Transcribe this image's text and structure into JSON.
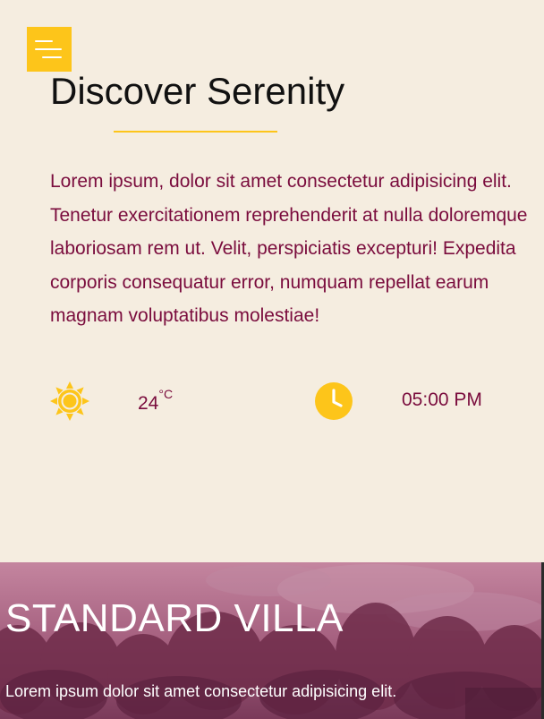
{
  "colors": {
    "background": "#f5ede0",
    "accent": "#fdc51a",
    "text_primary": "#7a0c3d",
    "heading": "#111111",
    "card_overlay": "#a0587a"
  },
  "header": {
    "menu_icon": "hamburger-menu-icon"
  },
  "hero": {
    "title": "Discover Serenity",
    "description_lines": [
      "Lorem ipsum, dolor sit amet consectetur adipisicing elit.",
      "Tenetur exercitationem reprehenderit at nulla doloremque",
      "laboriosam rem ut. Velit, perspiciatis excepturi! Expedita",
      "corporis consequatur error, numquam repellat earum",
      "magnam voluptatibus molestiae!"
    ]
  },
  "info": {
    "weather_icon": "sun-icon",
    "temperature": "24",
    "temperature_unit": "°C",
    "time_icon": "clock-icon",
    "time": "05:00 PM"
  },
  "villa_card": {
    "title": "STANDARD VILLA",
    "text": "Lorem ipsum dolor sit amet consectetur adipisicing elit."
  }
}
